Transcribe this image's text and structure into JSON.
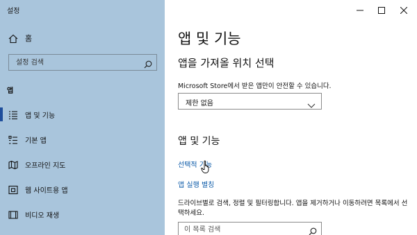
{
  "window": {
    "title": "설정"
  },
  "sidebar": {
    "home_label": "홈",
    "search_placeholder": "설정 검색",
    "section_label": "앱",
    "items": [
      {
        "label": "앱 및 기능",
        "icon": "list-icon",
        "active": true
      },
      {
        "label": "기본 앱",
        "icon": "default-apps-icon",
        "active": false
      },
      {
        "label": "오프라인 지도",
        "icon": "map-icon",
        "active": false
      },
      {
        "label": "웹 사이트용 앱",
        "icon": "web-apps-icon",
        "active": false
      },
      {
        "label": "비디오 재생",
        "icon": "video-icon",
        "active": false
      }
    ],
    "accent_color": "#1f4e9c",
    "background_color": "#a9c5dc"
  },
  "main": {
    "title": "앱 및 기능",
    "install_source": {
      "heading": "앱을 가져올 위치 선택",
      "description": "Microsoft Store에서 받은 앱만이 안전할 수 있습니다.",
      "selected": "제한 없음"
    },
    "apps_features": {
      "heading": "앱 및 기능",
      "link_optional": "선택적 기능",
      "link_aliases": "앱 실행 별칭",
      "description": "드라이브별로 검색, 정렬 및 필터링합니다. 앱을 제거하거나 이동하려면 목록에서 선택하세요.",
      "search_placeholder": "이 목록 검색"
    },
    "link_color": "#0b5aa8"
  }
}
